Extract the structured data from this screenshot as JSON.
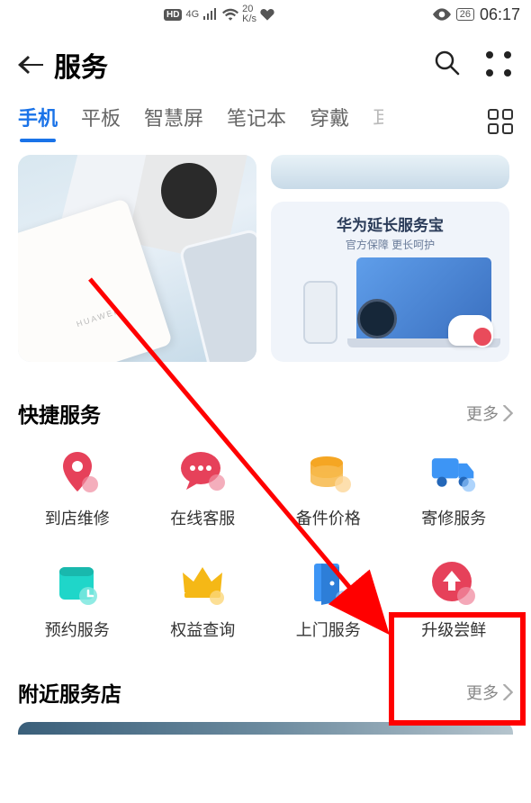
{
  "status": {
    "hd": "HD",
    "network": "4G",
    "speed_value": "20",
    "speed_unit": "K/s",
    "battery": "26",
    "time": "06:17"
  },
  "header": {
    "title": "服务"
  },
  "tabs": {
    "items": [
      {
        "label": "手机",
        "active": true
      },
      {
        "label": "平板",
        "active": false
      },
      {
        "label": "智慧屏",
        "active": false
      },
      {
        "label": "笔记本",
        "active": false
      },
      {
        "label": "穿戴",
        "active": false
      }
    ]
  },
  "banner": {
    "left_brand": "HUAWEI",
    "ext_title": "华为延长服务宝",
    "ext_subtitle": "官方保障  更长呵护"
  },
  "quick_services": {
    "title": "快捷服务",
    "more": "更多",
    "items": [
      {
        "label": "到店维修",
        "name": "store-repair"
      },
      {
        "label": "在线客服",
        "name": "online-support"
      },
      {
        "label": "备件价格",
        "name": "parts-price"
      },
      {
        "label": "寄修服务",
        "name": "mail-repair"
      },
      {
        "label": "预约服务",
        "name": "appointment"
      },
      {
        "label": "权益查询",
        "name": "benefits"
      },
      {
        "label": "上门服务",
        "name": "door-service"
      },
      {
        "label": "升级尝鲜",
        "name": "upgrade-beta"
      }
    ]
  },
  "nearby_stores": {
    "title": "附近服务店",
    "more": "更多"
  },
  "colors": {
    "accent_red": "#e6415a",
    "accent_orange": "#f5a623",
    "accent_blue": "#1a73e8",
    "accent_teal": "#1fd6c9",
    "annotation_red": "#ff0000"
  }
}
